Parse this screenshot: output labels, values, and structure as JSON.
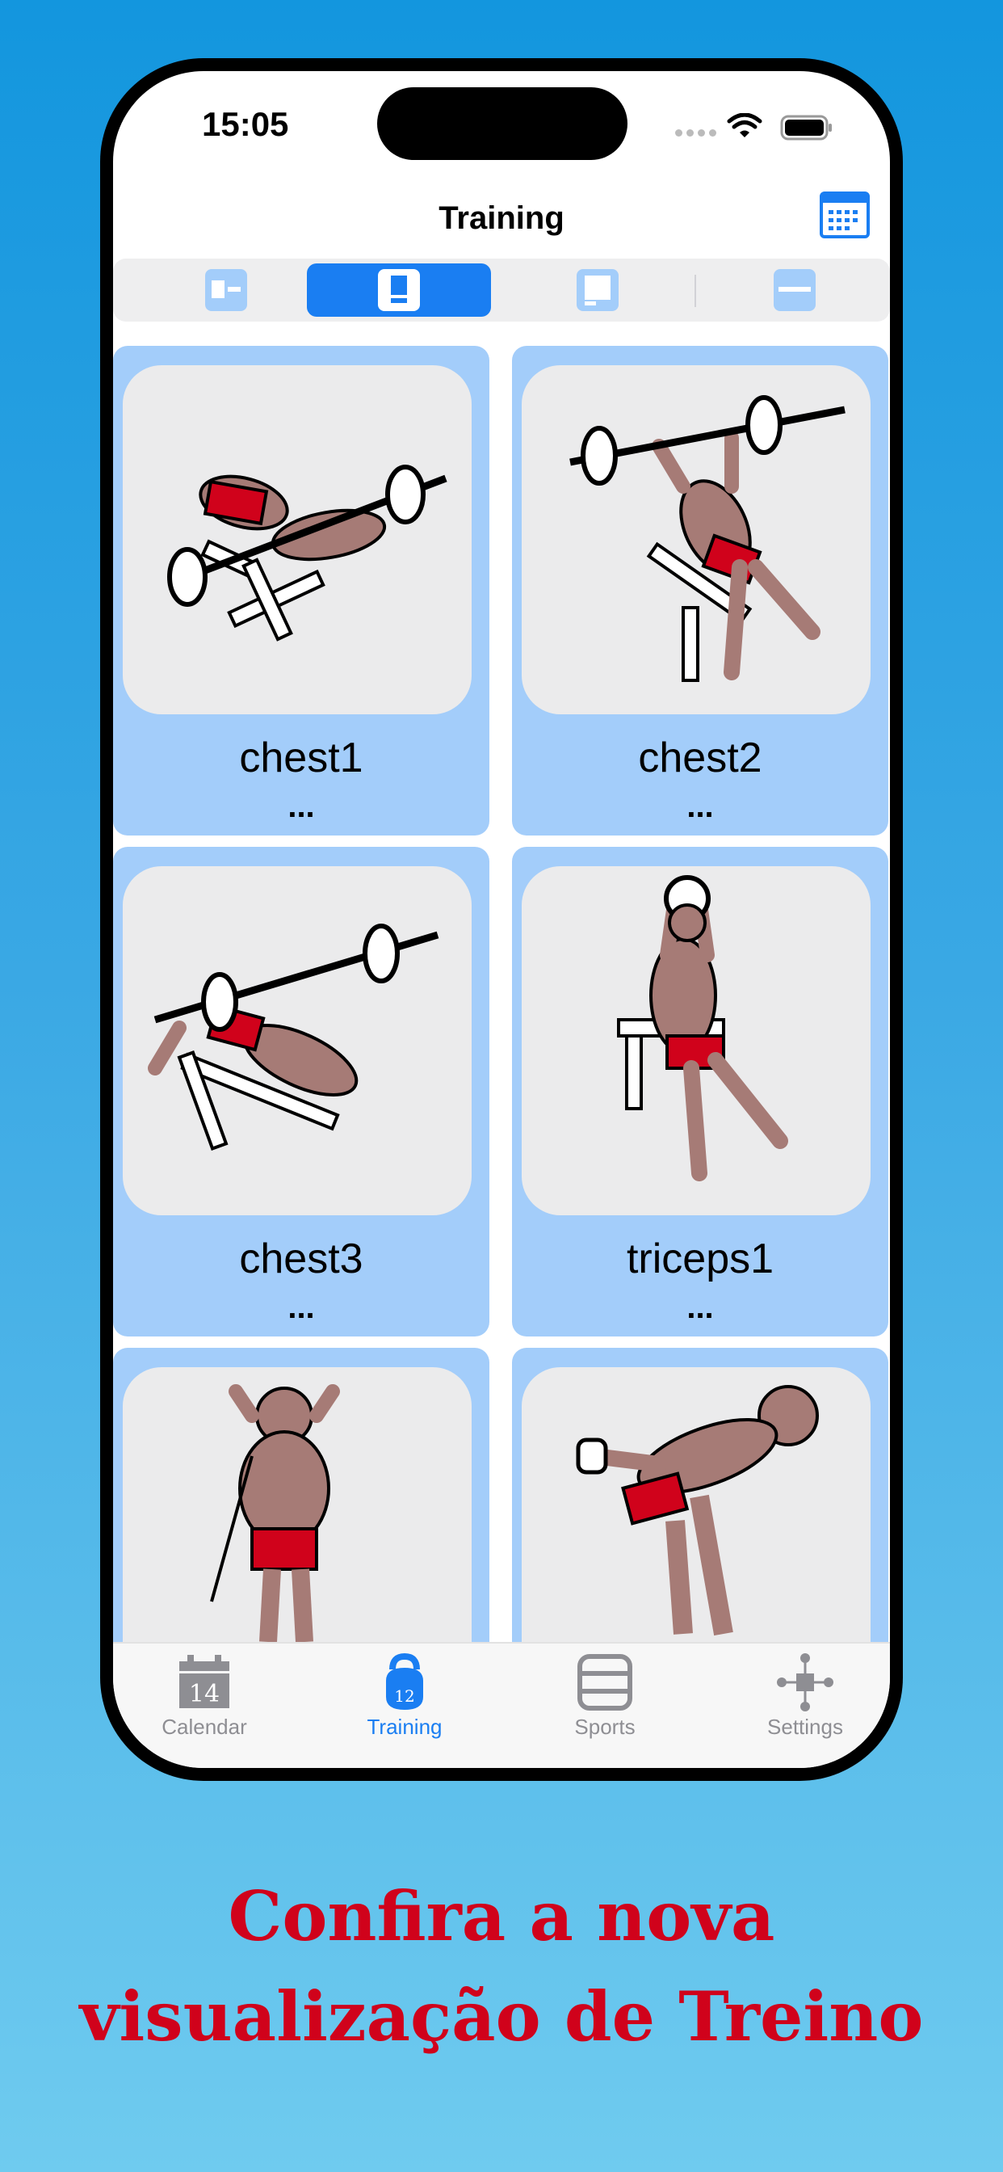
{
  "status_bar": {
    "time": "15:05"
  },
  "nav": {
    "title": "Training",
    "calendar_icon": "calendar-grid-icon"
  },
  "segmented": {
    "segments": [
      {
        "icon": "layout-list-icon",
        "selected": false
      },
      {
        "icon": "layout-card-icon",
        "selected": true
      },
      {
        "icon": "layout-tablet-icon",
        "selected": false
      },
      {
        "icon": "layout-bar-icon",
        "selected": false
      }
    ]
  },
  "exercises": [
    {
      "name": "chest1",
      "detail": "..."
    },
    {
      "name": "chest2",
      "detail": "..."
    },
    {
      "name": "chest3",
      "detail": "..."
    },
    {
      "name": "triceps1",
      "detail": "..."
    },
    {
      "name": "",
      "detail": ""
    },
    {
      "name": "",
      "detail": ""
    }
  ],
  "tabbar": {
    "tabs": [
      {
        "label": "Calendar",
        "icon_text": "14",
        "active": false
      },
      {
        "label": "Training",
        "icon_text": "12",
        "active": true
      },
      {
        "label": "Sports",
        "active": false
      },
      {
        "label": "Settings",
        "active": false
      }
    ]
  },
  "colors": {
    "accent": "#1a7ef2",
    "card_background": "#a3cdfa",
    "promo_text": "#d0021b"
  },
  "promo": {
    "line1": "Confira a nova",
    "line2": "visualização de Treino"
  }
}
